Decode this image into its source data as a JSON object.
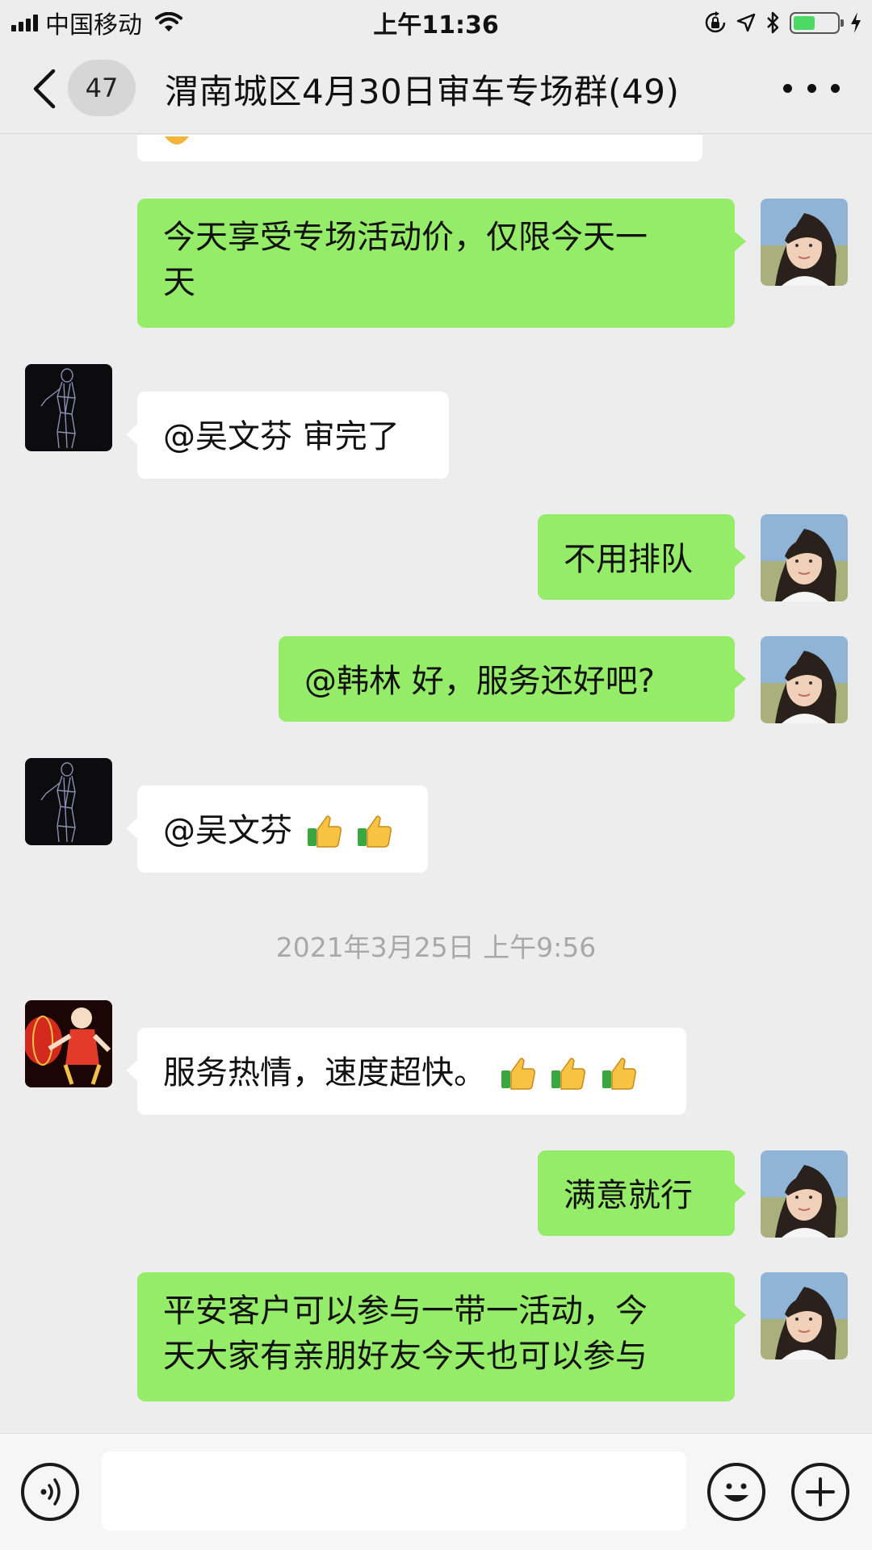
{
  "status_bar": {
    "carrier": "中国移动",
    "time": "上午11:36",
    "battery_level": 0.5,
    "icons": [
      "signal-icon",
      "wifi-icon",
      "rotation-lock-icon",
      "location-icon",
      "bluetooth-icon",
      "battery-icon",
      "charging-icon"
    ]
  },
  "nav": {
    "back_icon": "chevron-left-icon",
    "unread_count": "47",
    "title": "渭南城区4月30日审车专场群(49)",
    "more_icon": "more-dots-icon"
  },
  "chat": {
    "messages": [
      {
        "side": "left",
        "text": "",
        "avatar": "avatar-wireframe-figure"
      },
      {
        "side": "right",
        "text_lines": [
          "今天享受专场活动价，仅限今天一",
          "天"
        ],
        "avatar": "avatar-girl-photo"
      },
      {
        "side": "left",
        "text": "@吴文芬 审完了",
        "avatar": "avatar-wireframe-figure"
      },
      {
        "side": "right",
        "text": "不用排队",
        "avatar": "avatar-girl-photo"
      },
      {
        "side": "right",
        "text": "@韩林 好，服务还好吧?",
        "avatar": "avatar-girl-photo"
      },
      {
        "side": "left",
        "text": "@吴文芬",
        "emoji": [
          "thumbs-up-emoji",
          "thumbs-up-emoji"
        ],
        "avatar": "avatar-wireframe-figure"
      },
      {
        "side": "left",
        "text": "服务热情，速度超快。",
        "emoji": [
          "thumbs-up-emoji",
          "thumbs-up-emoji",
          "thumbs-up-emoji"
        ],
        "avatar": "avatar-lantern-doll"
      },
      {
        "side": "right",
        "text": "满意就行",
        "avatar": "avatar-girl-photo"
      },
      {
        "side": "right",
        "text_lines": [
          "平安客户可以参与一带一活动，今",
          "天大家有亲朋好友今天也可以参与"
        ],
        "avatar": "avatar-girl-photo"
      }
    ],
    "timestamp": "2021年3月25日 上午9:56"
  },
  "input_bar": {
    "voice_icon": "voice-icon",
    "input_value": "",
    "emoji_icon": "emoji-icon",
    "plus_icon": "plus-icon"
  },
  "colors": {
    "background": "#ededed",
    "bubble_self": "#95ec69",
    "bubble_other": "#ffffff",
    "timestamp_text": "#a8a8a8",
    "battery_fill": "#4cd964"
  }
}
